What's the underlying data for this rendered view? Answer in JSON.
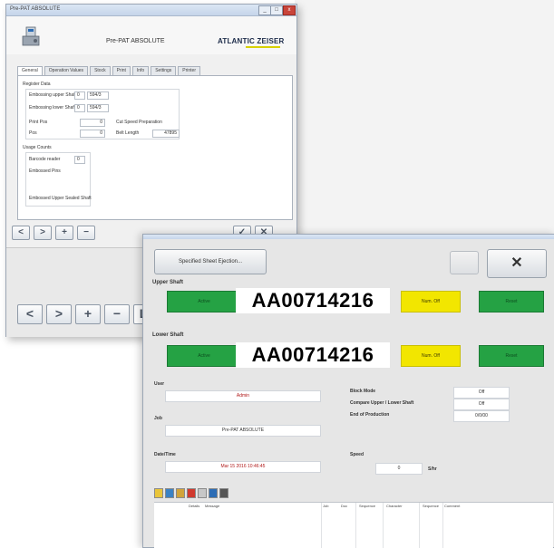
{
  "back_window": {
    "title": "Pre-PAT ABSOLUTE",
    "program_title": "Pre-PAT ABSOLUTE",
    "brand": "ATLANTIC ZEISER",
    "tabs": [
      "General",
      "Operation Values",
      "Stock",
      "Print",
      "Info",
      "Settings",
      "Printer"
    ],
    "groups": {
      "register_group": "Register Data",
      "codes_group": "Usage Counts"
    },
    "fields": [
      {
        "label": "Embossing upper Shaft",
        "value_a": "0",
        "value_b": "594/3"
      },
      {
        "label": "Embossing lower Shaft",
        "value_a": "0",
        "value_b": "594/3"
      },
      {
        "label": "Print Pos",
        "value_a": "0"
      },
      {
        "label": "Pos",
        "value_a": "0"
      },
      {
        "label": "Cut Speed Preparation",
        "value_a": ""
      },
      {
        "label": "Belt Length",
        "value_a": "47895"
      }
    ],
    "usage": [
      {
        "label": "Barcode reader",
        "value": "0"
      },
      {
        "label": "Embossed Pins"
      },
      {
        "label": "Embossed Upper Sealed Shaft"
      }
    ],
    "nav_buttons": [
      "<",
      ">",
      "+",
      "−"
    ],
    "confirm_buttons": [
      "✓",
      "✕"
    ],
    "lower_nav": [
      "<",
      ">",
      "+",
      "−"
    ],
    "lower_label": "L"
  },
  "front_window": {
    "top_button": "Specified Sheet Ejection...",
    "disabled_btn": "",
    "close_btn": "✕",
    "upper_shaft": {
      "label": "Upper Shaft",
      "left_button": "Active",
      "code": "AA00714216",
      "status": "Num. Off",
      "right_button": "Reset"
    },
    "lower_shaft": {
      "label": "Lower Shaft",
      "left_button": "Active",
      "code": "AA00714216",
      "status": "Num. Off",
      "right_button": "Reset"
    },
    "user": {
      "label": "User",
      "value": "Admin"
    },
    "job": {
      "label": "Job",
      "value": "Pre-PAT ABSOLUTE"
    },
    "datetime": {
      "label": "Date/Time",
      "value": "Mar 15 2016   10:46:45"
    },
    "options": [
      {
        "label": "Block Mode",
        "value": "Off"
      },
      {
        "label": "Compare Upper / Lower Shaft",
        "value": "Off"
      },
      {
        "label": "End of Production",
        "value": "0/0/00"
      }
    ],
    "speed": {
      "label": "Speed",
      "value": "0",
      "unit": "S/hr"
    },
    "log_columns": [
      "Details",
      "Message",
      "Job",
      "Doc",
      "Sequence",
      "Character",
      "Sequence",
      "Comment"
    ]
  },
  "colors": {
    "green": "#25a244",
    "yellow": "#f2e600",
    "red_text": "#b01818"
  }
}
